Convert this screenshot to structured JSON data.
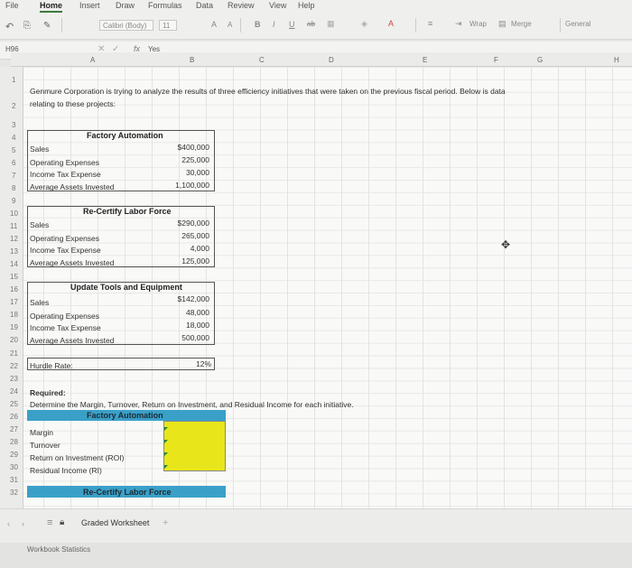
{
  "menu": [
    "File",
    "Home",
    "Insert",
    "Draw",
    "Formulas",
    "Data",
    "Review",
    "View",
    "Help"
  ],
  "ribbon": {
    "font_name": "Calibri (Body)",
    "font_size": "11",
    "wrap_label": "Wrap",
    "merge_label": "Merge",
    "number_format": "General"
  },
  "formula_bar": {
    "name_box": "H96",
    "fx": "fx",
    "value": "Yes"
  },
  "columns": [
    "A",
    "B",
    "C",
    "D",
    "E",
    "F",
    "G",
    "H"
  ],
  "rows": [
    "1",
    "2",
    "3",
    "4",
    "5",
    "6",
    "7",
    "8",
    "9",
    "10",
    "11",
    "12",
    "13",
    "14",
    "15",
    "16",
    "17",
    "18",
    "19",
    "20",
    "21",
    "22",
    "23",
    "24",
    "25",
    "26",
    "27",
    "28",
    "29",
    "30",
    "31",
    "32"
  ],
  "intro": {
    "line1": "Genmure Corporation is trying to analyze the results of three efficiency initiatives that were taken on the previous fiscal period. Below is data",
    "line2": "relating to these projects:"
  },
  "projects": [
    {
      "title": "Factory Automation",
      "sales": "$400,000",
      "opex": "225,000",
      "tax": "30,000",
      "assets": "1,100,000"
    },
    {
      "title": "Re-Certify Labor Force",
      "sales": "$290,000",
      "opex": "265,000",
      "tax": "4,000",
      "assets": "125,000"
    },
    {
      "title": "Update Tools and Equipment",
      "sales": "$142,000",
      "opex": "48,000",
      "tax": "18,000",
      "assets": "500,000"
    }
  ],
  "labels": {
    "sales": "Sales",
    "opex": "Operating Expenses",
    "tax": "Income Tax Expense",
    "assets": "Average Assets Invested",
    "hurdle": "Hurdle Rate:",
    "required": "Required:",
    "required_text": "Determine the Margin, Turnover, Return on Investment, and Residual Income for each initiative.",
    "margin": "Margin",
    "turnover": "Turnover",
    "roi": "Return on Investment (ROI)",
    "ri": "Residual Income (RI)"
  },
  "hurdle_rate": "12%",
  "answer_sections": [
    "Factory Automation",
    "Re-Certify Labor Force"
  ],
  "sheet_tab": "Graded Worksheet",
  "status": "Workbook Statistics",
  "colors": {
    "accent_green": "#3c7a3c",
    "teal_header": "#3aa0c8",
    "yellow_input": "#e8e61a"
  }
}
